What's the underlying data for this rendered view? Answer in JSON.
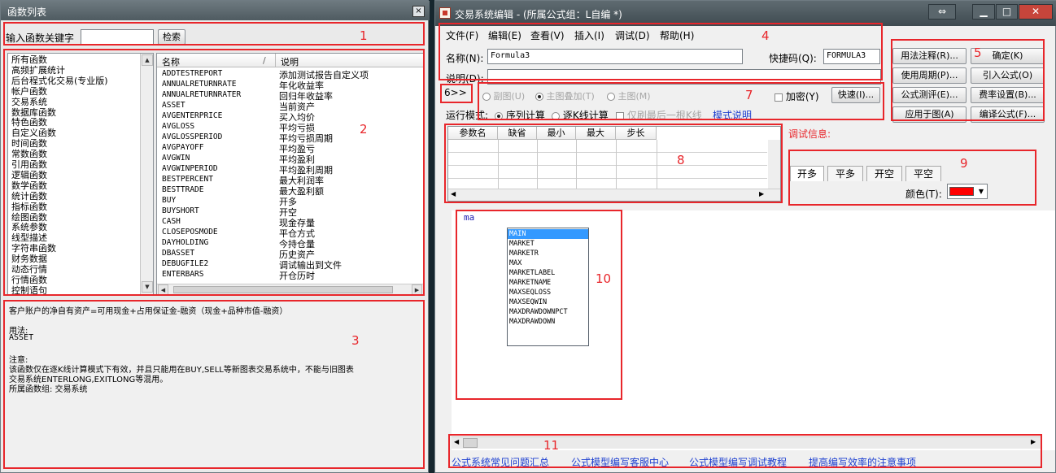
{
  "left_window": {
    "title": "函数列表",
    "close_label": "×",
    "search_label": "输入函数关键字",
    "search_value": "",
    "search_button": "检索",
    "categories": [
      "所有函数",
      "高频扩展统计",
      "后台程式化交易(专业版)",
      "帐户函数",
      "交易系统",
      "数据库函数",
      "特色函数",
      "自定义函数",
      "时间函数",
      "常数函数",
      "引用函数",
      "逻辑函数",
      "数学函数",
      "统计函数",
      "指标函数",
      "绘图函数",
      "系统参数",
      "线型描述",
      "字符串函数",
      "财务数据",
      "动态行情",
      "行情函数",
      "控制语句"
    ],
    "columns": {
      "name": "名称",
      "desc": "说明"
    },
    "functions": [
      {
        "name": "ADDTESTREPORT",
        "desc": "添加测试报告自定义项"
      },
      {
        "name": "ANNUALRETURNRATE",
        "desc": "年化收益率"
      },
      {
        "name": "ANNUALRETURNRATER",
        "desc": "回归年收益率"
      },
      {
        "name": "ASSET",
        "desc": "当前资产"
      },
      {
        "name": "AVGENTERPRICE",
        "desc": "买入均价"
      },
      {
        "name": "AVGLOSS",
        "desc": "平均亏损"
      },
      {
        "name": "AVGLOSSPERIOD",
        "desc": "平均亏损周期"
      },
      {
        "name": "AVGPAYOFF",
        "desc": "平均盈亏"
      },
      {
        "name": "AVGWIN",
        "desc": "平均盈利"
      },
      {
        "name": "AVGWINPERIOD",
        "desc": "平均盈利周期"
      },
      {
        "name": "BESTPERCENT",
        "desc": "最大利润率"
      },
      {
        "name": "BESTTRADE",
        "desc": "最大盈利额"
      },
      {
        "name": "BUY",
        "desc": "开多"
      },
      {
        "name": "BUYSHORT",
        "desc": "开空"
      },
      {
        "name": "CASH",
        "desc": "现金存量"
      },
      {
        "name": "CLOSEPOSMODE",
        "desc": "平仓方式"
      },
      {
        "name": "DAYHOLDING",
        "desc": "今持仓量"
      },
      {
        "name": "DBASSET",
        "desc": "历史资产"
      },
      {
        "name": "DEBUGFILE2",
        "desc": "调试输出到文件"
      },
      {
        "name": "ENTERBARS",
        "desc": "开仓历时"
      }
    ],
    "description": {
      "line1": "客户账户的净自有资产=可用现金+占用保证金-融资（现金+品种市值-融资）",
      "usage_label": "用法:",
      "usage_value": "ASSET",
      "note_label": "注意:",
      "note_line1": "该函数仅在逐K线计算模式下有效，并且只能用在BUY,SELL等新图表交易系统中，不能与旧图表",
      "note_line2": "交易系统ENTERLONG,EXITLONG等混用。",
      "group": "所属函数组: 交易系统"
    }
  },
  "right_window": {
    "title": "交易系统编辑 - (所属公式组：L自编 *)",
    "menu": [
      "文件(F)",
      "编辑(E)",
      "查看(V)",
      "插入(I)",
      "调试(D)",
      "帮助(H)"
    ],
    "name_label": "名称(N):",
    "name_value": "Formula3",
    "shortcut_label": "快捷码(Q):",
    "shortcut_value": "FORMULA3",
    "desc_label": "说明(D):",
    "desc_value": "",
    "expand_button": "6>>",
    "chart_modes": [
      "副图(U)",
      "主图叠加(T)",
      "主图(M)"
    ],
    "encrypt_label": "加密(Y)",
    "quick_button": "快速(I)...",
    "run_mode_label": "运行模式:",
    "run_modes": [
      "序列计算",
      "逐K线计算"
    ],
    "refresh_label": "仅刷最后一根K线",
    "mode_help_link": "模式说明",
    "right_buttons": [
      "用法注释(R)...",
      "确定(K)",
      "使用周期(P)...",
      "引入公式(O)",
      "公式测评(E)...",
      "费率设置(B)...",
      "应用于图(A)",
      "编译公式(F)..."
    ],
    "param_headers": [
      "参数名",
      "缺省",
      "最小",
      "最大",
      "步长"
    ],
    "debug_label": "调试信息:",
    "tabs": [
      "开多",
      "平多",
      "开空",
      "平空"
    ],
    "color_label": "颜色(T):",
    "color_value": "#ff0000",
    "editor_text": "ma",
    "autocomplete": [
      "MAIN",
      "MARKET",
      "MARKETR",
      "MAX",
      "MARKETLABEL",
      "MARKETNAME",
      "MAXSEQLOSS",
      "MAXSEQWIN",
      "MAXDRAWDOWNPCT",
      "MAXDRAWDOWN"
    ],
    "links": [
      "公式系统常见问题汇总",
      "公式模型编写客服中心",
      "公式模型编写调试教程",
      "提高编写效率的注意事项"
    ]
  },
  "annotations": [
    "1",
    "2",
    "3",
    "4",
    "5",
    "6",
    "7",
    "8",
    "9",
    "10",
    "11"
  ]
}
